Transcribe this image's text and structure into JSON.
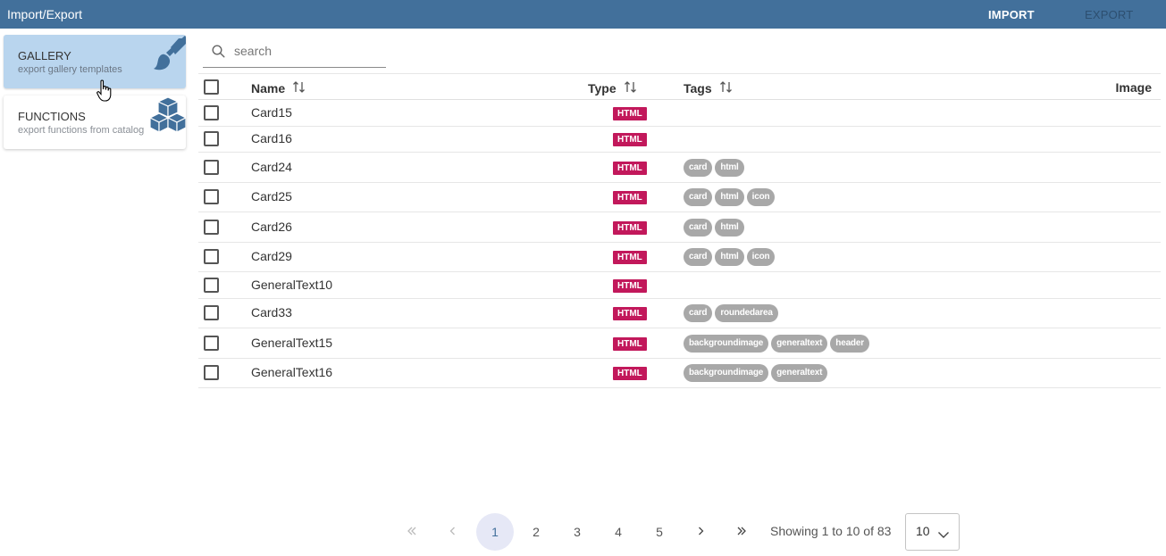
{
  "header": {
    "title": "Import/Export",
    "import_label": "IMPORT",
    "export_label": "EXPORT"
  },
  "sidebar": {
    "cards": [
      {
        "title": "GALLERY",
        "subtitle": "export gallery templates",
        "icon": "paintbrush-icon"
      },
      {
        "title": "FUNCTIONS",
        "subtitle": "export functions from catalog",
        "icon": "cubes-icon"
      }
    ]
  },
  "search": {
    "placeholder": "search",
    "value": ""
  },
  "table": {
    "columns": {
      "name": "Name",
      "type": "Type",
      "tags": "Tags",
      "image": "Image"
    },
    "rows": [
      {
        "name": "Card15",
        "type": "HTML",
        "tags": []
      },
      {
        "name": "Card16",
        "type": "HTML",
        "tags": []
      },
      {
        "name": "Card24",
        "type": "HTML",
        "tags": [
          "card",
          "html"
        ]
      },
      {
        "name": "Card25",
        "type": "HTML",
        "tags": [
          "card",
          "html",
          "icon"
        ]
      },
      {
        "name": "Card26",
        "type": "HTML",
        "tags": [
          "card",
          "html"
        ]
      },
      {
        "name": "Card29",
        "type": "HTML",
        "tags": [
          "card",
          "html",
          "icon"
        ]
      },
      {
        "name": "GeneralText10",
        "type": "HTML",
        "tags": []
      },
      {
        "name": "Card33",
        "type": "HTML",
        "tags": [
          "card",
          "roundedarea"
        ]
      },
      {
        "name": "GeneralText15",
        "type": "HTML",
        "tags": [
          "backgroundimage",
          "generaltext",
          "header"
        ]
      },
      {
        "name": "GeneralText16",
        "type": "HTML",
        "tags": [
          "backgroundimage",
          "generaltext"
        ]
      }
    ]
  },
  "pagination": {
    "pages": [
      "1",
      "2",
      "3",
      "4",
      "5"
    ],
    "current_page": "1",
    "showing_text": "Showing 1 to 10 of 83",
    "rows_per_page": "10"
  },
  "colors": {
    "header_bg": "#42709b",
    "active_card_bg": "#b9d5ee",
    "type_badge": "#c2185b",
    "tag_bg": "#a8a8a8",
    "active_page_bg": "#e6e8f6"
  }
}
